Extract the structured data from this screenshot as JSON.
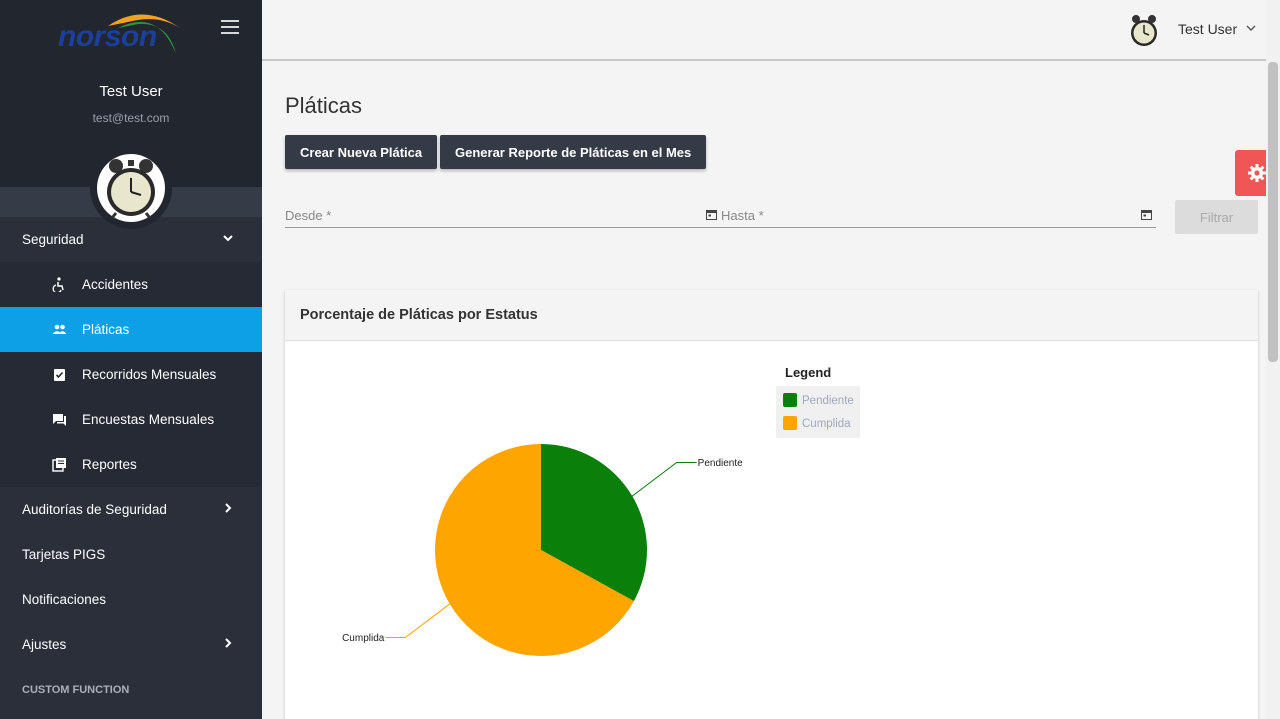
{
  "brand": {
    "logo_text": "norson"
  },
  "sidebar": {
    "user_name": "Test User",
    "user_email": "test@test.com",
    "items": [
      {
        "label": "Seguridad"
      },
      {
        "label": "Accidentes"
      },
      {
        "label": "Pláticas"
      },
      {
        "label": "Recorridos Mensuales"
      },
      {
        "label": "Encuestas Mensuales"
      },
      {
        "label": "Reportes"
      },
      {
        "label": "Auditorías de Seguridad"
      },
      {
        "label": "Tarjetas PIGS"
      },
      {
        "label": "Notificaciones"
      },
      {
        "label": "Ajustes"
      }
    ],
    "section_label": "CUSTOM FUNCTION"
  },
  "topbar": {
    "user_name": "Test User"
  },
  "main": {
    "title": "Pláticas",
    "create_button": "Crear Nueva Plática",
    "report_button": "Generar Reporte de Pláticas en el Mes",
    "from_label": "Desde *",
    "to_label": "Hasta *",
    "filter_button": "Filtrar",
    "card_title": "Porcentaje de Pláticas por Estatus"
  },
  "colors": {
    "accent": "#0ea0e6",
    "pendiente": "#0a7f0a",
    "cumplida": "#ffa500",
    "settings": "#f05656"
  },
  "chart_data": {
    "type": "pie",
    "legend_title": "Legend",
    "legend_position": "top-right",
    "slices": [
      {
        "label": "Pendiente",
        "value": 33,
        "color": "#0a7f0a"
      },
      {
        "label": "Cumplida",
        "value": 67,
        "color": "#ffa500"
      }
    ]
  }
}
